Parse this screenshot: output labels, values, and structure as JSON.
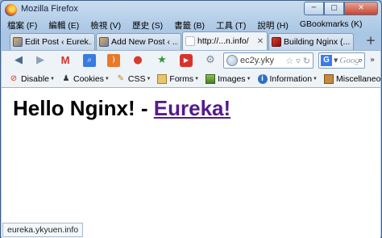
{
  "window": {
    "title": "Mozilla Firefox",
    "minimize": "─",
    "maximize": "▢",
    "close": "✕"
  },
  "menu": [
    "檔案 (F)",
    "編輯 (E)",
    "檢視 (V)",
    "歷史 (S)",
    "書籤 (B)",
    "工具 (T)",
    "說明 (H)",
    "GBookmarks (K)"
  ],
  "tabs": [
    {
      "label": "Edit Post ‹ Eurek...",
      "close": ""
    },
    {
      "label": "Add New Post ‹ ...",
      "close": ""
    },
    {
      "label": "http://...n.info/",
      "close": "✕"
    },
    {
      "label": "Building Nginx (...",
      "close": ""
    }
  ],
  "newtab": "+",
  "nav": {
    "url": "ec2y.yky",
    "search_placeholder": "Google",
    "search_engine": "G"
  },
  "devbar": [
    {
      "label": "Disable",
      "icon": "disable-icon"
    },
    {
      "label": "Cookies",
      "icon": "cookies-icon"
    },
    {
      "label": "CSS",
      "icon": "css-icon"
    },
    {
      "label": "Forms",
      "icon": "forms-icon"
    },
    {
      "label": "Images",
      "icon": "images-icon"
    },
    {
      "label": "Information",
      "icon": "information-icon"
    },
    {
      "label": "Miscellaneous",
      "icon": "miscellaneous-icon"
    }
  ],
  "page": {
    "heading_text": "Hello Nginx! - ",
    "heading_link": "Eureka!"
  },
  "status": "eureka.ykyuen.info",
  "colors": {
    "link_visited": "#551a8b",
    "chrome": "#eef3f8"
  }
}
